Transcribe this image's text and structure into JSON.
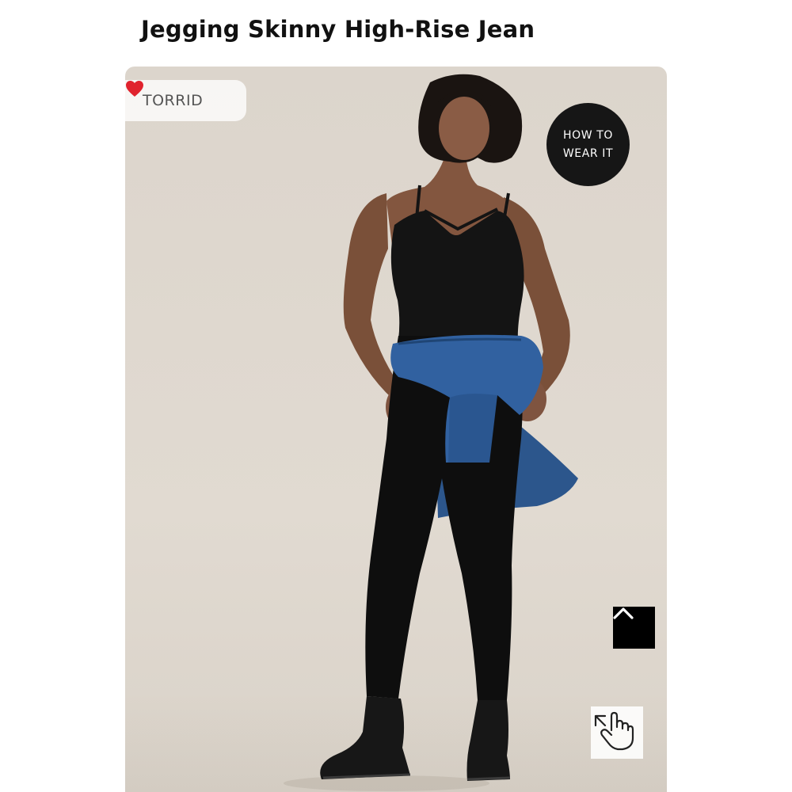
{
  "product": {
    "title": "Jegging Skinny High-Rise Jean"
  },
  "badge": {
    "brand": "TORRID",
    "icon": "heart-icon",
    "heart_color": "#e0232e"
  },
  "how_to_wear": {
    "line1": "HOW TO",
    "line2": "WEAR IT"
  },
  "controls": {
    "scroll_top_icon": "chevron-up-icon",
    "zoom_icon": "hand-expand-icon"
  },
  "colors": {
    "background": "#ffffff",
    "photo_backdrop": "#ddd6cd",
    "outfit": "#121212",
    "denim": "#2f5a93"
  }
}
